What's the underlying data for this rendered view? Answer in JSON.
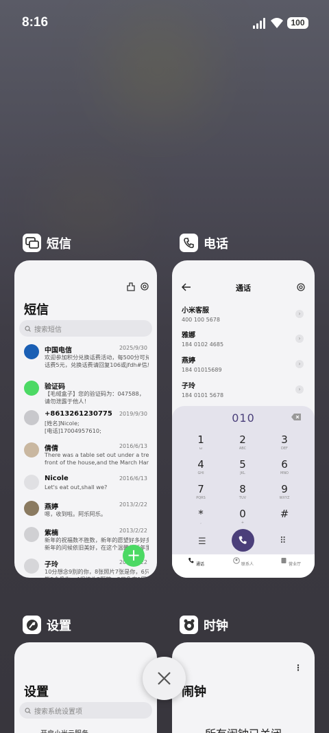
{
  "status_bar": {
    "time": "8:16",
    "battery": "100"
  },
  "apps": {
    "sms": {
      "name": "短信",
      "title": "短信",
      "search_placeholder": "搜索短信",
      "messages": [
        {
          "name": "中国电信",
          "date": "2025/9/30",
          "line1": "欢迎参加积分兑换话费活动，每500分可兑换",
          "line2": "话费5元，兑换话费请回复106或jfdh#信息..."
        },
        {
          "name": "验证码",
          "date": "",
          "line1": "【毛绒盒子】您的验证码为：047588，",
          "line2": "请勿泄露于他人！"
        },
        {
          "name": "+8613261230775",
          "date": "2019/9/30",
          "line1": "[姓名]Nicole;",
          "line2": "[电话]17004957610;"
        },
        {
          "name": "倩倩",
          "date": "2016/6/13",
          "line1": "There was a table set out under a tree in",
          "line2": "front of the house,and the March Hare an..."
        },
        {
          "name": "Nicole",
          "date": "2016/6/13",
          "line1": "Let's eat out,shall we?",
          "line2": ""
        },
        {
          "name": "燕婷",
          "date": "2013/2/22",
          "line1": "嗯，收到啦。阿乐阿乐。",
          "line2": ""
        },
        {
          "name": "紫楠",
          "date": "2013/2/22",
          "line1": "新年的祝福数不胜数，新年的愿望好多好多，",
          "line2": "新年的问候依旧美好，在这个温馨的新年里..."
        },
        {
          "name": "子玲",
          "date": "2013/2/22",
          "line1": "10分想念9别的你，8张照片7张是你，6只小",
          "line2": "熊5个像你，4根棒头3颗糖，2只象奔1回..."
        }
      ]
    },
    "phone": {
      "name": "电话",
      "title": "通话",
      "contacts": [
        {
          "name": "小米客服",
          "number": "400 100 5678"
        },
        {
          "name": "雅娜",
          "number": "184 0102 4685"
        },
        {
          "name": "燕婷",
          "number": "184 01015689"
        },
        {
          "name": "子玲",
          "number": "184 0101 5678"
        }
      ],
      "dialed": "010",
      "keys": [
        {
          "d": "1",
          "l": "ω"
        },
        {
          "d": "2",
          "l": "ABC"
        },
        {
          "d": "3",
          "l": "DEF"
        },
        {
          "d": "4",
          "l": "GHI"
        },
        {
          "d": "5",
          "l": "JKL"
        },
        {
          "d": "6",
          "l": "MNO"
        },
        {
          "d": "7",
          "l": "PQRS"
        },
        {
          "d": "8",
          "l": "TUV"
        },
        {
          "d": "9",
          "l": "WXYZ"
        },
        {
          "d": "*",
          "l": ","
        },
        {
          "d": "0",
          "l": "+"
        },
        {
          "d": "#",
          "l": ""
        }
      ],
      "tabs": [
        "通话",
        "联系人",
        "营业厅"
      ]
    },
    "settings": {
      "name": "设置",
      "title": "设置",
      "search_placeholder": "搜索系统设置项",
      "first_item": "开启小米云服务"
    },
    "clock": {
      "name": "时钟",
      "title": "闹钟",
      "empty_text": "所有闹钟已关闭"
    }
  },
  "colors": {
    "fab": "#4cd964",
    "call": "#4b3f7a",
    "dialpad_bg": "#e4e3ec"
  }
}
